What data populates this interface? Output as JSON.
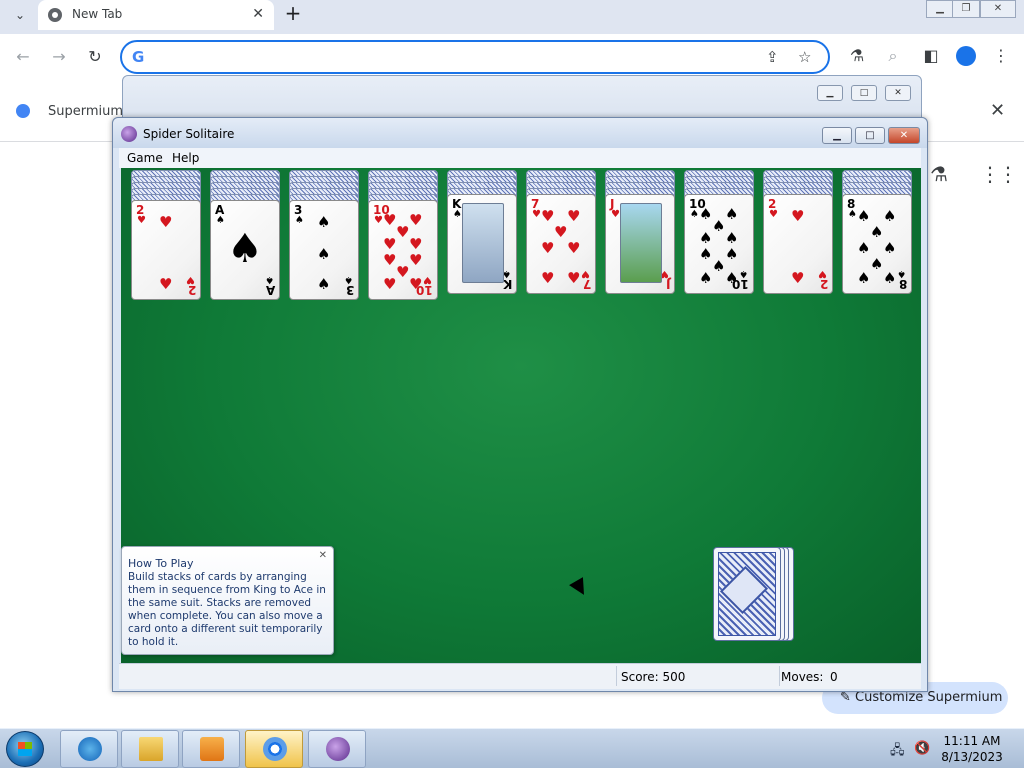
{
  "browser": {
    "tab_title": "New Tab",
    "bookmark_label": "Supermium i",
    "customize_label": "Customize Supermium"
  },
  "spider": {
    "title": "Spider Solitaire",
    "menu": [
      "Game",
      "Help"
    ],
    "score_label": "Score: 500",
    "moves_label": "Moves:",
    "moves_value": "0",
    "howto_title": "How To Play",
    "howto_body": "Build stacks of cards by arranging them in sequence from King to Ace in the same suit. Stacks are removed when complete. You can also move a card onto a different suit temporarily to hold it.",
    "stock_count": 4,
    "piles": [
      {
        "rank": "2",
        "suit": "♥",
        "color": "red",
        "backs": 5
      },
      {
        "rank": "A",
        "suit": "♠",
        "color": "black",
        "backs": 5
      },
      {
        "rank": "3",
        "suit": "♠",
        "color": "black",
        "backs": 5
      },
      {
        "rank": "10",
        "suit": "♥",
        "color": "red",
        "backs": 5
      },
      {
        "rank": "K",
        "suit": "♠",
        "color": "black",
        "backs": 4
      },
      {
        "rank": "7",
        "suit": "♥",
        "color": "red",
        "backs": 4
      },
      {
        "rank": "J",
        "suit": "♥",
        "color": "red",
        "backs": 4
      },
      {
        "rank": "10",
        "suit": "♠",
        "color": "black",
        "backs": 4
      },
      {
        "rank": "2",
        "suit": "♥",
        "color": "red",
        "backs": 4
      },
      {
        "rank": "8",
        "suit": "♠",
        "color": "black",
        "backs": 4
      }
    ]
  },
  "taskbar": {
    "time": "11:11 AM",
    "date": "8/13/2023"
  },
  "colors": {
    "felt": "#0f7a37",
    "omnibox_border": "#1a73e8",
    "red_suit": "#d4171f"
  },
  "icons": {
    "tab_search": "chevron-down-icon",
    "new_tab": "plus-icon",
    "back": "arrow-left-icon",
    "forward": "arrow-right-icon",
    "reload": "reload-icon",
    "share": "share-icon",
    "star": "star-icon",
    "labs": "flask-icon",
    "apps": "apps-grid-icon"
  }
}
